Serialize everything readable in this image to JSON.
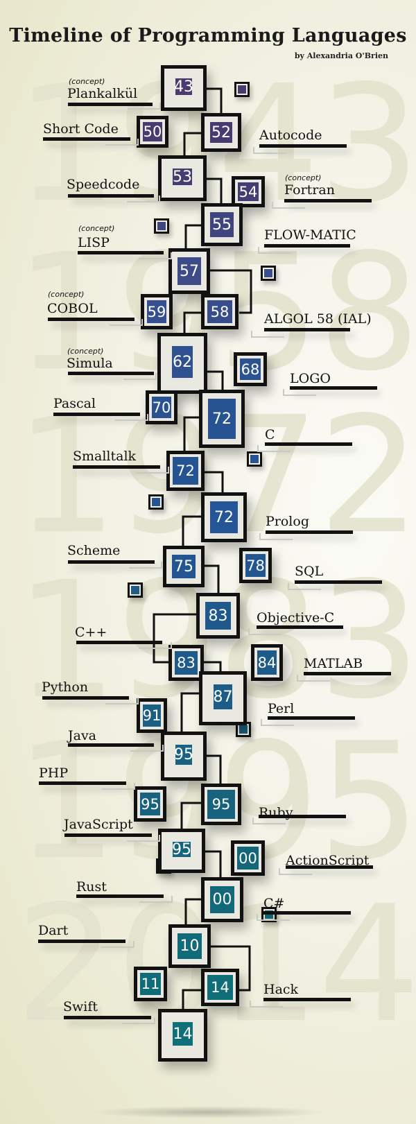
{
  "header": {
    "title": "Timeline of Programming Languages",
    "byline": "by Alexandria O'Brien"
  },
  "background_years": [
    "1943",
    "1958",
    "1972",
    "1983",
    "1995",
    "2014"
  ],
  "concept_tag": "(concept)",
  "colors": {
    "purple": "#4a3a6e",
    "indigo": "#3e4a86",
    "blue": "#254f8f",
    "steel_blue": "#1e5a8a",
    "teal_blue": "#16607a",
    "teal": "#0f7077",
    "frame": "#111111",
    "background": "#f3f2e6"
  },
  "languages": [
    {
      "name": "Plankalkül",
      "year": "43",
      "concept": true
    },
    {
      "name": "Short Code",
      "year": "50",
      "concept": false
    },
    {
      "name": "Autocode",
      "year": "52",
      "concept": false
    },
    {
      "name": "Speedcode",
      "year": "53",
      "concept": false
    },
    {
      "name": "Fortran",
      "year": "54",
      "concept": true
    },
    {
      "name": "FLOW-MATIC",
      "year": "55",
      "concept": false
    },
    {
      "name": "LISP",
      "year": "57",
      "concept": true
    },
    {
      "name": "COBOL",
      "year": "59",
      "concept": true
    },
    {
      "name": "ALGOL 58 (IAL)",
      "year": "58",
      "concept": false
    },
    {
      "name": "Simula",
      "year": "62",
      "concept": true
    },
    {
      "name": "LOGO",
      "year": "68",
      "concept": false
    },
    {
      "name": "Pascal",
      "year": "70",
      "concept": false
    },
    {
      "name": "C",
      "year": "72",
      "concept": false
    },
    {
      "name": "Smalltalk",
      "year": "72",
      "concept": false
    },
    {
      "name": "Prolog",
      "year": "72",
      "concept": false
    },
    {
      "name": "Scheme",
      "year": "75",
      "concept": false
    },
    {
      "name": "SQL",
      "year": "78",
      "concept": false
    },
    {
      "name": "Objective-C",
      "year": "83",
      "concept": false
    },
    {
      "name": "C++",
      "year": "83",
      "concept": false
    },
    {
      "name": "MATLAB",
      "year": "84",
      "concept": false
    },
    {
      "name": "Perl",
      "year": "87",
      "concept": false
    },
    {
      "name": "Python",
      "year": "91",
      "concept": false
    },
    {
      "name": "Java",
      "year": "95",
      "concept": false
    },
    {
      "name": "PHP",
      "year": "95",
      "concept": false
    },
    {
      "name": "Ruby",
      "year": "95",
      "concept": false
    },
    {
      "name": "JavaScript",
      "year": "95",
      "concept": false
    },
    {
      "name": "ActionScript",
      "year": "00",
      "concept": false
    },
    {
      "name": "C#",
      "year": "00",
      "concept": false
    },
    {
      "name": "Rust",
      "year": "10",
      "concept": false
    },
    {
      "name": "Dart",
      "year": "11",
      "concept": false
    },
    {
      "name": "Hack",
      "year": "14",
      "concept": false
    },
    {
      "name": "Swift",
      "year": "14",
      "concept": false
    }
  ]
}
